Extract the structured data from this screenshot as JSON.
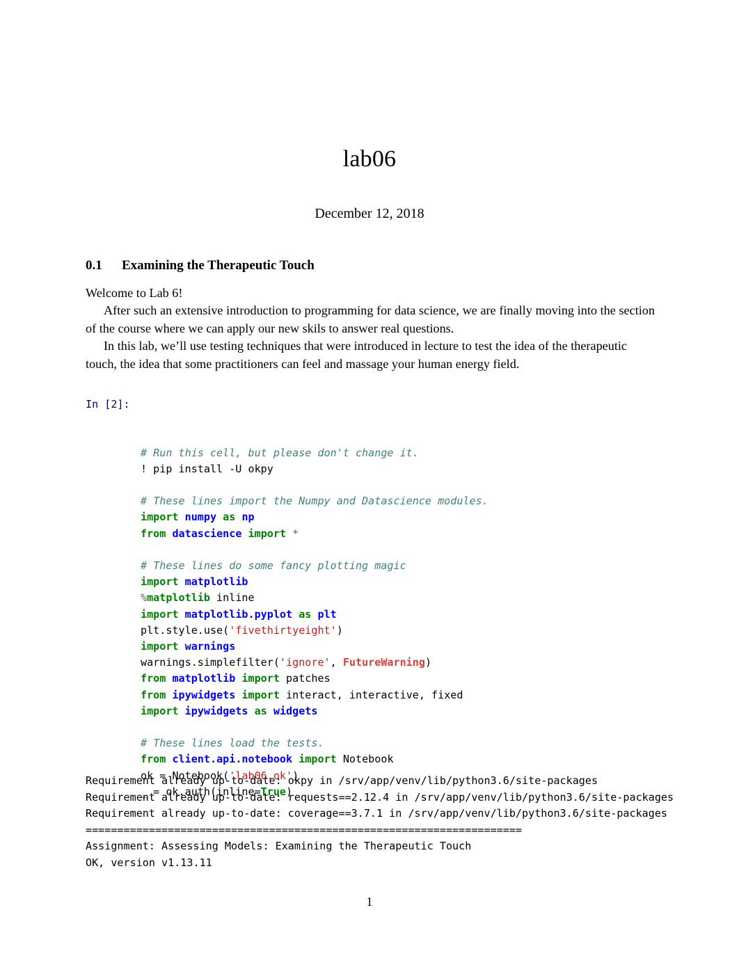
{
  "document": {
    "title": "lab06",
    "date": "December 12, 2018",
    "page_number": "1"
  },
  "section": {
    "number": "0.1",
    "heading": "Examining the Therapeutic Touch"
  },
  "body": {
    "paragraph_1": "Welcome to Lab 6!",
    "paragraph_2": "After such an extensive introduction to programming for data science, we are finally moving into the section of the course where we can apply our new skils to answer real questions.",
    "paragraph_3": "In this lab, we’ll use testing techniques that were introduced in lecture to test the idea of the therapeutic touch, the idea that some practitioners can feel and massage your human energy field."
  },
  "code_cell": {
    "prompt": "In [2]:",
    "lines": [
      {
        "tokens": [
          {
            "t": "comment",
            "s": "# Run this cell, but please don't change it."
          }
        ]
      },
      {
        "tokens": [
          {
            "t": "text",
            "s": "! pip install -U okpy"
          }
        ]
      },
      {
        "tokens": [
          {
            "t": "text",
            "s": ""
          }
        ]
      },
      {
        "tokens": [
          {
            "t": "comment",
            "s": "# These lines import the Numpy and Datascience modules."
          }
        ]
      },
      {
        "tokens": [
          {
            "t": "keyword",
            "s": "import"
          },
          {
            "t": "text",
            "s": " "
          },
          {
            "t": "name",
            "s": "numpy"
          },
          {
            "t": "text",
            "s": " "
          },
          {
            "t": "keyword",
            "s": "as"
          },
          {
            "t": "text",
            "s": " "
          },
          {
            "t": "name",
            "s": "np"
          }
        ]
      },
      {
        "tokens": [
          {
            "t": "keyword",
            "s": "from"
          },
          {
            "t": "text",
            "s": " "
          },
          {
            "t": "name",
            "s": "datascience"
          },
          {
            "t": "text",
            "s": " "
          },
          {
            "t": "keyword",
            "s": "import"
          },
          {
            "t": "text",
            "s": " "
          },
          {
            "t": "op",
            "s": "*"
          }
        ]
      },
      {
        "tokens": [
          {
            "t": "text",
            "s": ""
          }
        ]
      },
      {
        "tokens": [
          {
            "t": "comment",
            "s": "# These lines do some fancy plotting magic"
          }
        ]
      },
      {
        "tokens": [
          {
            "t": "keyword",
            "s": "import"
          },
          {
            "t": "text",
            "s": " "
          },
          {
            "t": "name",
            "s": "matplotlib"
          }
        ]
      },
      {
        "tokens": [
          {
            "t": "op",
            "s": "%"
          },
          {
            "t": "magic",
            "s": "matplotlib"
          },
          {
            "t": "text",
            "s": " inline"
          }
        ]
      },
      {
        "tokens": [
          {
            "t": "keyword",
            "s": "import"
          },
          {
            "t": "text",
            "s": " "
          },
          {
            "t": "name",
            "s": "matplotlib.pyplot"
          },
          {
            "t": "text",
            "s": " "
          },
          {
            "t": "keyword",
            "s": "as"
          },
          {
            "t": "text",
            "s": " "
          },
          {
            "t": "name",
            "s": "plt"
          }
        ]
      },
      {
        "tokens": [
          {
            "t": "text",
            "s": "plt.style.use("
          },
          {
            "t": "string",
            "s": "'fivethirtyeight'"
          },
          {
            "t": "text",
            "s": ")"
          }
        ]
      },
      {
        "tokens": [
          {
            "t": "keyword",
            "s": "import"
          },
          {
            "t": "text",
            "s": " "
          },
          {
            "t": "name",
            "s": "warnings"
          }
        ]
      },
      {
        "tokens": [
          {
            "t": "text",
            "s": "warnings.simplefilter("
          },
          {
            "t": "string",
            "s": "'ignore'"
          },
          {
            "t": "text",
            "s": ", "
          },
          {
            "t": "exception",
            "s": "FutureWarning"
          },
          {
            "t": "text",
            "s": ")"
          }
        ]
      },
      {
        "tokens": [
          {
            "t": "keyword",
            "s": "from"
          },
          {
            "t": "text",
            "s": " "
          },
          {
            "t": "name",
            "s": "matplotlib"
          },
          {
            "t": "text",
            "s": " "
          },
          {
            "t": "keyword",
            "s": "import"
          },
          {
            "t": "text",
            "s": " patches"
          }
        ]
      },
      {
        "tokens": [
          {
            "t": "keyword",
            "s": "from"
          },
          {
            "t": "text",
            "s": " "
          },
          {
            "t": "name",
            "s": "ipywidgets"
          },
          {
            "t": "text",
            "s": " "
          },
          {
            "t": "keyword",
            "s": "import"
          },
          {
            "t": "text",
            "s": " interact, interactive, fixed"
          }
        ]
      },
      {
        "tokens": [
          {
            "t": "keyword",
            "s": "import"
          },
          {
            "t": "text",
            "s": " "
          },
          {
            "t": "name",
            "s": "ipywidgets"
          },
          {
            "t": "text",
            "s": " "
          },
          {
            "t": "keyword",
            "s": "as"
          },
          {
            "t": "text",
            "s": " "
          },
          {
            "t": "name",
            "s": "widgets"
          }
        ]
      },
      {
        "tokens": [
          {
            "t": "text",
            "s": ""
          }
        ]
      },
      {
        "tokens": [
          {
            "t": "comment",
            "s": "# These lines load the tests."
          }
        ]
      },
      {
        "tokens": [
          {
            "t": "keyword",
            "s": "from"
          },
          {
            "t": "text",
            "s": " "
          },
          {
            "t": "name",
            "s": "client.api.notebook"
          },
          {
            "t": "text",
            "s": " "
          },
          {
            "t": "keyword",
            "s": "import"
          },
          {
            "t": "text",
            "s": " Notebook"
          }
        ]
      },
      {
        "tokens": [
          {
            "t": "text",
            "s": "ok = Notebook("
          },
          {
            "t": "string",
            "s": "'lab06.ok'"
          },
          {
            "t": "text",
            "s": ")"
          }
        ]
      },
      {
        "tokens": [
          {
            "t": "text",
            "s": "_ = ok.auth(inline="
          },
          {
            "t": "keyword-const",
            "s": "True"
          },
          {
            "t": "text",
            "s": ")"
          }
        ]
      }
    ]
  },
  "output": {
    "lines": [
      "Requirement already up-to-date: okpy in /srv/app/venv/lib/python3.6/site-packages",
      "Requirement already up-to-date: requests==2.12.4 in /srv/app/venv/lib/python3.6/site-packages",
      "Requirement already up-to-date: coverage==3.7.1 in /srv/app/venv/lib/python3.6/site-packages",
      "=====================================================================",
      "Assignment: Assessing Models: Examining the Therapeutic Touch",
      "OK, version v1.13.11"
    ]
  },
  "colors": {
    "prompt": "#000080",
    "comment": "#408080",
    "keyword": "#008000",
    "name": "#0000FF",
    "string": "#BA2121",
    "exception": "#D2413A",
    "operator": "#666666",
    "text": "#000000",
    "background": "#FFFFFF"
  }
}
